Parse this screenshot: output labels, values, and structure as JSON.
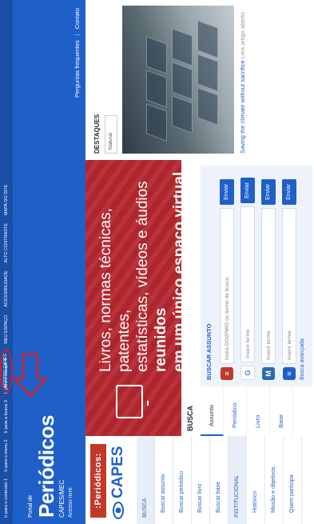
{
  "topbar": {
    "accessibility_links": [
      "Ir para o conteúdo 1",
      "Ir para o menu 2",
      "Ir para a busca 3",
      "Ir para o rodapé 4"
    ],
    "nav_links": [
      "ACESSO CAPES",
      "MEU ESPAÇO",
      "ACESSIBILIDADE",
      "ALTO CONTRASTE",
      "MAPA DO SITE"
    ]
  },
  "header": {
    "portal_label": "Portal de",
    "title": "Periódicos",
    "subtitle": "CAPES/MEC",
    "access_label": "Acesso livre",
    "links": [
      "Perguntas frequentes",
      "Contato"
    ]
  },
  "logo": {
    "badge": ":Periódicos:",
    "capes": "CAPES"
  },
  "sidebar": {
    "items": [
      {
        "label": "BUSCA",
        "type": "section"
      },
      {
        "label": "Buscar assunto",
        "type": "sub"
      },
      {
        "label": "Buscar periódico",
        "type": "sub"
      },
      {
        "label": "Buscar livro",
        "type": "sub"
      },
      {
        "label": "Buscar base",
        "type": "sub"
      },
      {
        "label": "INSTITUCIONAL",
        "type": "section"
      },
      {
        "label": "Histórico",
        "type": "sub"
      },
      {
        "label": "Missão e objetivos",
        "type": "sub"
      },
      {
        "label": "Quem participa",
        "type": "sub"
      }
    ]
  },
  "hero": {
    "line1": "Livros, normas técnicas, patentes,",
    "line2": "estatísticas, vídeos e áudios",
    "bold": "reunidos",
    "line3": "em um único espaço virtual"
  },
  "search": {
    "title": "BUSCA",
    "tabs": [
      "Assunto",
      "Periódico",
      "Livro",
      "Base"
    ],
    "panel_label": "BUSCAR ASSUNTO",
    "rows": [
      {
        "icon": "ezproxy-icon",
        "icon_glyph": "≡",
        "icon_color": "#c0392b",
        "placeholder": "Insira DOI/PMID ou termo de busca",
        "button": "Enviar"
      },
      {
        "icon": "google-icon",
        "icon_glyph": "G",
        "icon_color": "#4285f4",
        "placeholder": "Inserir termo",
        "button": "Enviar"
      },
      {
        "icon": "lm-icon",
        "icon_glyph": "M",
        "icon_color": "#2b6cb0",
        "placeholder": "Inserir termo",
        "button": "Enviar"
      },
      {
        "icon": "scholar-icon",
        "icon_glyph": "≈",
        "icon_color": "#1f60c8",
        "placeholder": "Inserir termo",
        "button": "Enviar"
      }
    ],
    "advanced": "Busca avançada"
  },
  "destaques": {
    "title": "DESTAQUES",
    "tag": "Natural",
    "caption_link": "Saving the climate without sacrifice",
    "caption_muted": "Leia artigo aberto"
  },
  "colors": {
    "brand_blue": "#1f60c8",
    "hero_red": "#b7282f",
    "annotation_red": "#d0202c"
  }
}
